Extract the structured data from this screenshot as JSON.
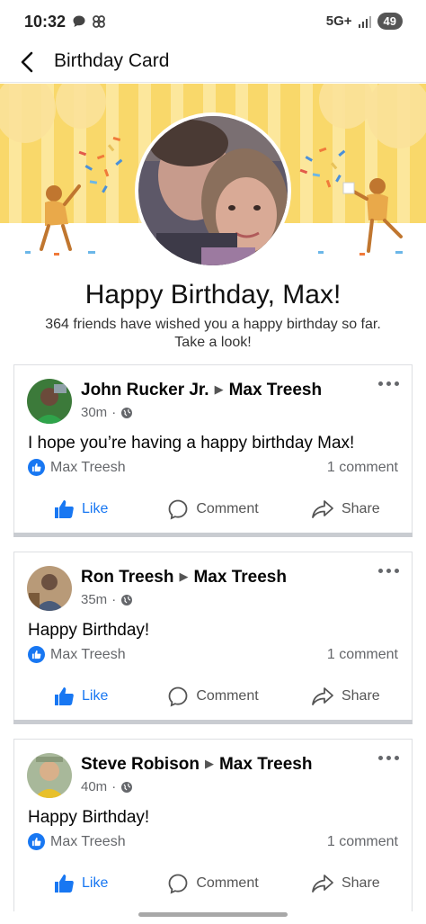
{
  "status_bar": {
    "time": "10:32",
    "network": "5G+",
    "battery": "49"
  },
  "header": {
    "title": "Birthday Card"
  },
  "card": {
    "title": "Happy Birthday, Max!",
    "subtitle": "364 friends have wished you a happy birthday so far. Take a look!"
  },
  "posts": [
    {
      "author": "John Rucker Jr.",
      "recipient": "Max Treesh",
      "time": "30m",
      "text": "I hope you’re having a happy birthday Max!",
      "liker": "Max Treesh",
      "comments": "1 comment"
    },
    {
      "author": "Ron Treesh",
      "recipient": "Max Treesh",
      "time": "35m",
      "text": "Happy Birthday!",
      "liker": "Max Treesh",
      "comments": "1 comment"
    },
    {
      "author": "Steve Robison",
      "recipient": "Max Treesh",
      "time": "40m",
      "text": "Happy Birthday!",
      "liker": "Max Treesh",
      "comments": "1 comment"
    }
  ],
  "actions": {
    "like": "Like",
    "comment": "Comment",
    "share": "Share"
  },
  "colors": {
    "accent": "#1877f2",
    "banner_yellow": "#f9d86a",
    "banner_stripe": "#fce79c"
  }
}
